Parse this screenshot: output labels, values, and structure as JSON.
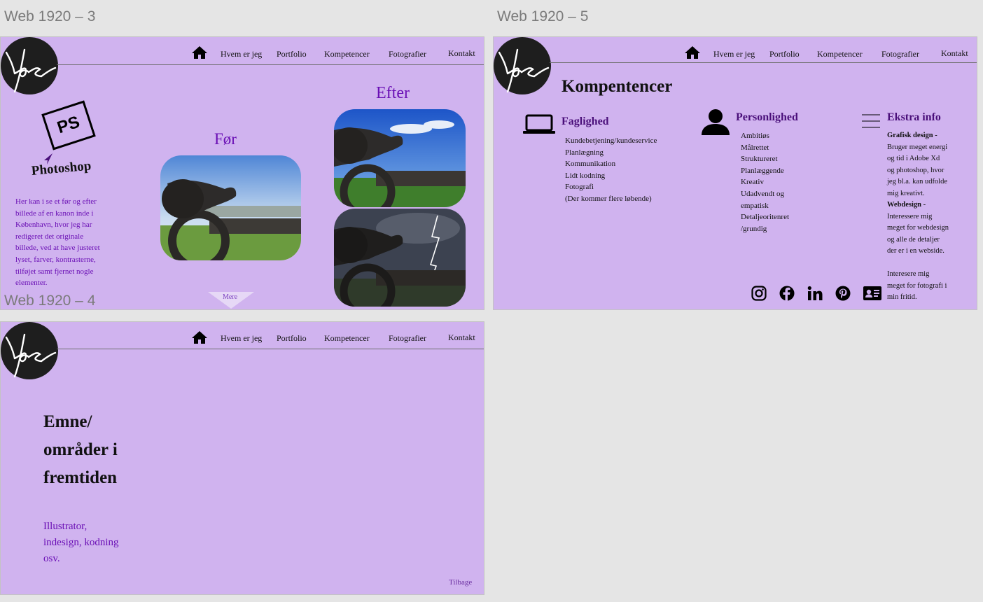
{
  "labels": {
    "frame3": "Web 1920 – 3",
    "frame5": "Web 1920 – 5",
    "frame4": "Web 1920 – 4"
  },
  "nav": {
    "items": [
      "Hvem er jeg",
      "Portfolio",
      "Kompetencer",
      "Fotografier",
      "Kontakt"
    ]
  },
  "frame3": {
    "ps_badge": "PS",
    "photoshop_title": "Photoshop",
    "description_lines": [
      "Her kan i se et før og efter",
      "billede af en kanon inde i",
      "København, hvor jeg har",
      "redigeret det originale",
      "billede, ved at have justeret",
      "lyset, farver, kontrasterne,",
      "tilføjet samt fjernet nogle",
      "elementer."
    ],
    "before_title": "Før",
    "after_title": "Efter",
    "more_button": "Mere"
  },
  "frame5": {
    "title": "Kompentencer",
    "faglighed": {
      "title": "Faglighed",
      "items": [
        "Kundebetjening/kundeservice",
        "Planlægning",
        "Kommunikation",
        "Lidt kodning",
        "Fotografi",
        "(Der kommer flere løbende)"
      ]
    },
    "personlighed": {
      "title": "Personlighed",
      "items": [
        "Ambitiøs",
        "Målrettet",
        "Struktureret",
        "Planlæggende",
        "Kreativ",
        "Udadvendt og",
        "empatisk",
        "Detaljeoritenret",
        "/grundig"
      ]
    },
    "ekstra": {
      "title": "Ekstra info",
      "lines": [
        {
          "text": "Grafisk design -",
          "bold": true
        },
        {
          "text": "Bruger meget energi",
          "bold": false
        },
        {
          "text": "og tid i Adobe Xd",
          "bold": false
        },
        {
          "text": "og photoshop, hvor",
          "bold": false
        },
        {
          "text": "jeg bl.a. kan udfolde",
          "bold": false
        },
        {
          "text": "mig kreativt.",
          "bold": false
        },
        {
          "text": "Webdesign -",
          "bold": true
        },
        {
          "text": "Interessere mig",
          "bold": false
        },
        {
          "text": "meget for webdesign",
          "bold": false
        },
        {
          "text": "og alle de detaljer",
          "bold": false
        },
        {
          "text": "der er i en webside.",
          "bold": false
        },
        {
          "text": "",
          "bold": false
        },
        {
          "text": "Interesere mig",
          "bold": false
        },
        {
          "text": "meget for fotografi i",
          "bold": false
        },
        {
          "text": "min fritid.",
          "bold": false
        }
      ]
    },
    "socials": [
      "instagram-icon",
      "facebook-icon",
      "linkedin-icon",
      "pinterest-icon",
      "contact-card-icon"
    ]
  },
  "frame4": {
    "heading_lines": [
      "Emne/",
      "områder i",
      "fremtiden"
    ],
    "subtext_lines": [
      "Illustrator,",
      "indesign, kodning",
      "osv."
    ],
    "back_link": "Tilbage"
  },
  "colors": {
    "artboard": "#d0b3ef",
    "accent_purple": "#6a0fb5",
    "dark_purple": "#4a0f7a",
    "logo": "#1e1e1e",
    "canvas": "#e5e5e5"
  }
}
